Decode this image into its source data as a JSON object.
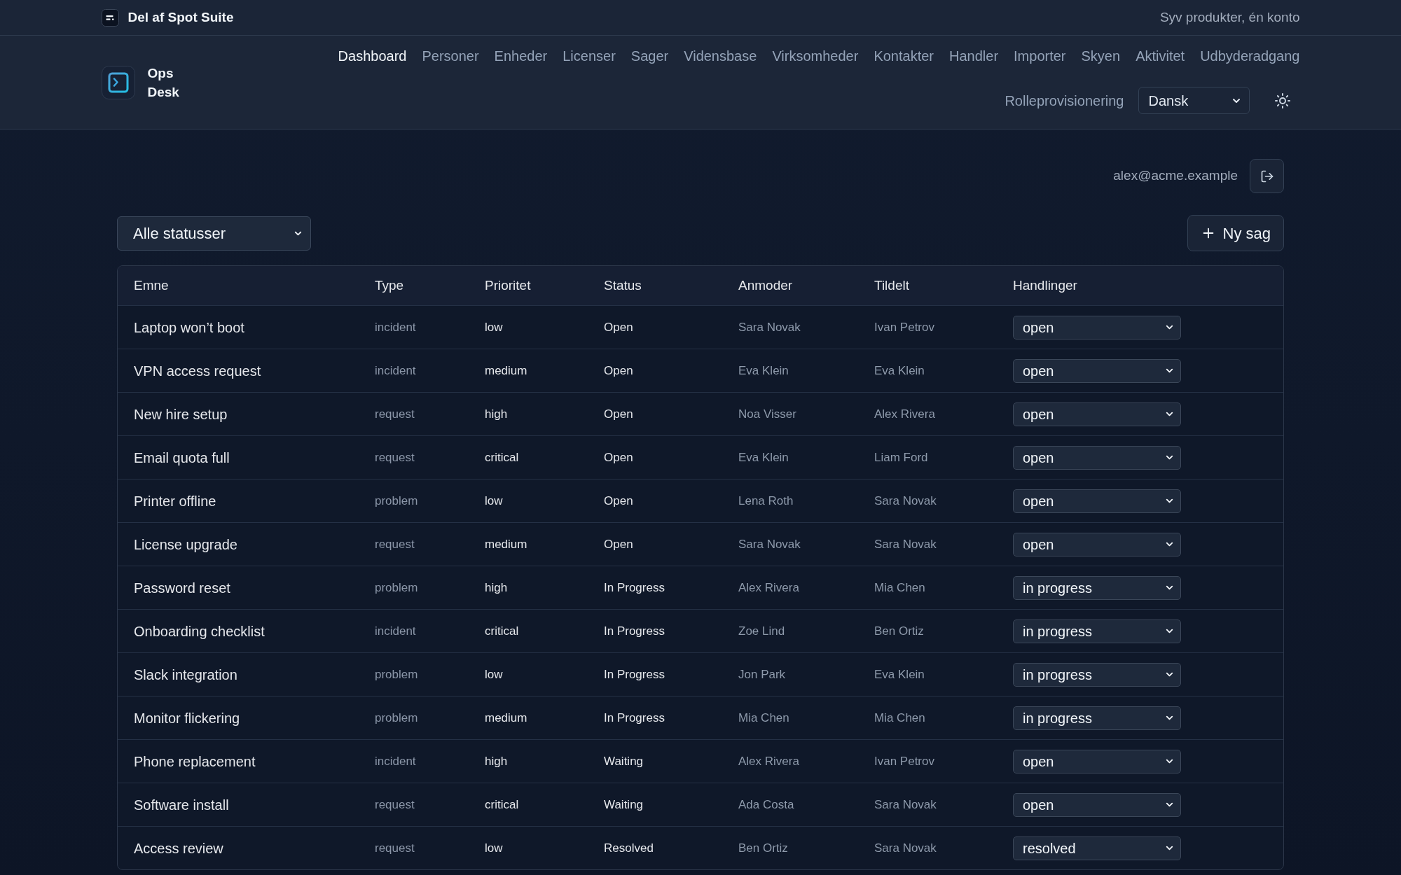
{
  "suite_bar": {
    "title": "Del af Spot Suite",
    "tagline": "Syv produkter, én konto"
  },
  "header": {
    "app_name": "Ops Desk"
  },
  "nav": {
    "primary": [
      {
        "label": "Dashboard",
        "selected": true
      },
      {
        "label": "Personer",
        "selected": false
      },
      {
        "label": "Enheder",
        "selected": false
      },
      {
        "label": "Licenser",
        "selected": false
      },
      {
        "label": "Sager",
        "selected": false
      },
      {
        "label": "Vidensbase",
        "selected": false
      },
      {
        "label": "Virksomheder",
        "selected": false
      },
      {
        "label": "Kontakter",
        "selected": false
      },
      {
        "label": "Handler",
        "selected": false
      },
      {
        "label": "Importer",
        "selected": false
      },
      {
        "label": "Skyen",
        "selected": false
      },
      {
        "label": "Aktivitet",
        "selected": false
      },
      {
        "label": "Udbyderadgang",
        "selected": false
      }
    ],
    "secondary": [
      {
        "label": "Rolleprovisionering",
        "selected": false
      }
    ]
  },
  "language_select": {
    "value": "Dansk"
  },
  "account": {
    "email": "alex@acme.example"
  },
  "status_filter": {
    "value": "Alle statusser"
  },
  "new_case_button": {
    "label": "Ny sag"
  },
  "table": {
    "columns": [
      "Emne",
      "Type",
      "Prioritet",
      "Status",
      "Anmoder",
      "Tildelt",
      "Handlinger"
    ],
    "rows": [
      {
        "subject": "Laptop won’t boot",
        "type": "incident",
        "priority": "low",
        "status": "Open",
        "requester": "Sara Novak",
        "assignee": "Ivan Petrov",
        "action": "open"
      },
      {
        "subject": "VPN access request",
        "type": "incident",
        "priority": "medium",
        "status": "Open",
        "requester": "Eva Klein",
        "assignee": "Eva Klein",
        "action": "open"
      },
      {
        "subject": "New hire setup",
        "type": "request",
        "priority": "high",
        "status": "Open",
        "requester": "Noa Visser",
        "assignee": "Alex Rivera",
        "action": "open"
      },
      {
        "subject": "Email quota full",
        "type": "request",
        "priority": "critical",
        "status": "Open",
        "requester": "Eva Klein",
        "assignee": "Liam Ford",
        "action": "open"
      },
      {
        "subject": "Printer offline",
        "type": "problem",
        "priority": "low",
        "status": "Open",
        "requester": "Lena Roth",
        "assignee": "Sara Novak",
        "action": "open"
      },
      {
        "subject": "License upgrade",
        "type": "request",
        "priority": "medium",
        "status": "Open",
        "requester": "Sara Novak",
        "assignee": "Sara Novak",
        "action": "open"
      },
      {
        "subject": "Password reset",
        "type": "problem",
        "priority": "high",
        "status": "In Progress",
        "requester": "Alex Rivera",
        "assignee": "Mia Chen",
        "action": "in progress"
      },
      {
        "subject": "Onboarding checklist",
        "type": "incident",
        "priority": "critical",
        "status": "In Progress",
        "requester": "Zoe Lind",
        "assignee": "Ben Ortiz",
        "action": "in progress"
      },
      {
        "subject": "Slack integration",
        "type": "problem",
        "priority": "low",
        "status": "In Progress",
        "requester": "Jon Park",
        "assignee": "Eva Klein",
        "action": "in progress"
      },
      {
        "subject": "Monitor flickering",
        "type": "problem",
        "priority": "medium",
        "status": "In Progress",
        "requester": "Mia Chen",
        "assignee": "Mia Chen",
        "action": "in progress"
      },
      {
        "subject": "Phone replacement",
        "type": "incident",
        "priority": "high",
        "status": "Waiting",
        "requester": "Alex Rivera",
        "assignee": "Ivan Petrov",
        "action": "open"
      },
      {
        "subject": "Software install",
        "type": "request",
        "priority": "critical",
        "status": "Waiting",
        "requester": "Ada Costa",
        "assignee": "Sara Novak",
        "action": "open"
      },
      {
        "subject": "Access review",
        "type": "request",
        "priority": "low",
        "status": "Resolved",
        "requester": "Ben Ortiz",
        "assignee": "Sara Novak",
        "action": "resolved"
      }
    ]
  }
}
